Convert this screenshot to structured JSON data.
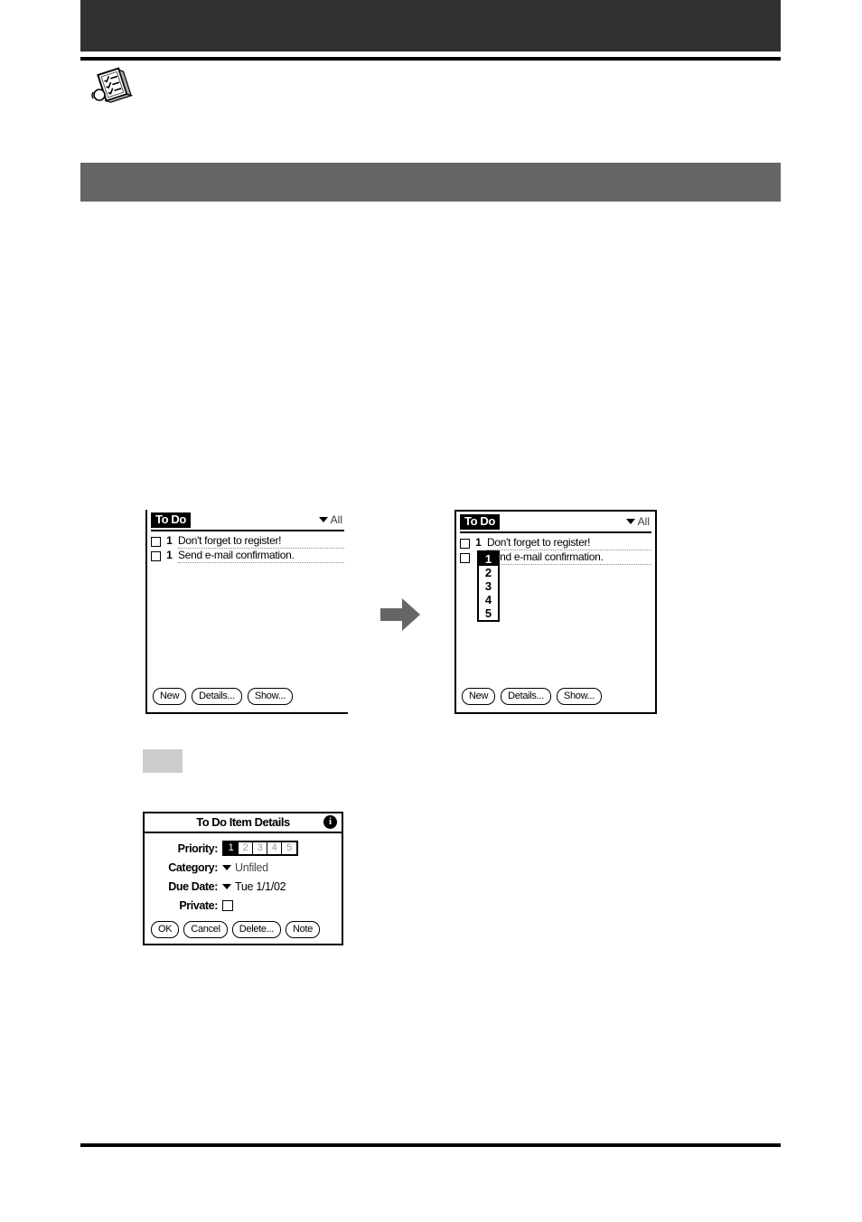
{
  "page": {
    "header_bar_color": "#313131",
    "section_bar_color": "#666666",
    "arrow_color": "#666666",
    "chip_color": "#cdcdcd"
  },
  "icons": {
    "note": "note-checklist-icon",
    "arrow": "right-arrow-icon",
    "info": "i",
    "category_caret": "chevron-down-icon"
  },
  "todo_list_before": {
    "title": "To Do",
    "category": "All",
    "items": [
      {
        "priority": "1",
        "text": "Don't forget to register!",
        "checked": false
      },
      {
        "priority": "1",
        "text": "Send e-mail confirmation.",
        "checked": false
      }
    ],
    "buttons": [
      "New",
      "Details...",
      "Show..."
    ]
  },
  "todo_list_after": {
    "title": "To Do",
    "category": "All",
    "items": [
      {
        "priority": "1",
        "text": "Don't forget to register!",
        "checked": false
      },
      {
        "priority": "1",
        "text": "Send e-mail confirmation.",
        "checked": false
      }
    ],
    "priority_popup": {
      "options": [
        "1",
        "2",
        "3",
        "4",
        "5"
      ],
      "selected": "1"
    },
    "buttons": [
      "New",
      "Details...",
      "Show..."
    ]
  },
  "details_dialog": {
    "title": "To Do Item Details",
    "info_icon_label": "i",
    "fields": {
      "priority": {
        "label": "Priority:",
        "options": [
          "1",
          "2",
          "3",
          "4",
          "5"
        ],
        "selected": "1"
      },
      "category": {
        "label": "Category:",
        "value": "Unfiled"
      },
      "due_date": {
        "label": "Due Date:",
        "value": "Tue 1/1/02"
      },
      "private": {
        "label": "Private:",
        "checked": false
      }
    },
    "buttons": [
      "OK",
      "Cancel",
      "Delete...",
      "Note"
    ]
  }
}
